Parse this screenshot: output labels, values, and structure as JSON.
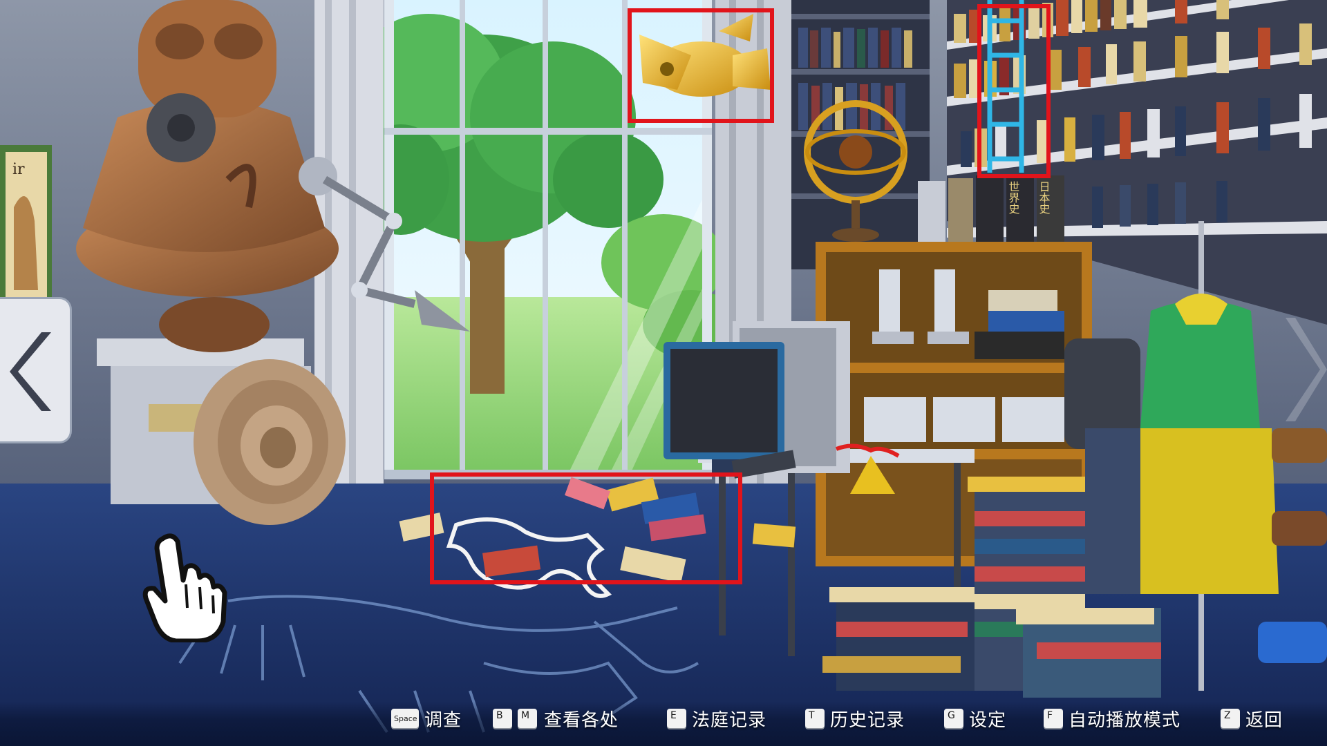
{
  "scene": {
    "wall_poster_text": "ir",
    "book_spines": [
      "世界史",
      "日本史"
    ]
  },
  "highlights": [
    "golden-flyer-artifact",
    "blue-ladder",
    "chalk-body-outline"
  ],
  "hotkeys": [
    {
      "keys": [
        "Space"
      ],
      "label": "调查"
    },
    {
      "keys": [
        "B",
        "M"
      ],
      "label": "查看各处"
    },
    {
      "keys": [
        "E"
      ],
      "label": "法庭记录"
    },
    {
      "keys": [
        "T"
      ],
      "label": "历史记录"
    },
    {
      "keys": [
        "G"
      ],
      "label": "设定"
    },
    {
      "keys": [
        "F"
      ],
      "label": "自动播放模式"
    },
    {
      "keys": [
        "Z"
      ],
      "label": "返回"
    }
  ],
  "colors": {
    "highlight": "#e1141b",
    "floor": "#1e3268",
    "hud_text": "#ffffff"
  },
  "icons": {
    "nav_left": "chevron-left-icon",
    "nav_right": "chevron-right-icon",
    "pointer": "hand-pointer-icon"
  }
}
